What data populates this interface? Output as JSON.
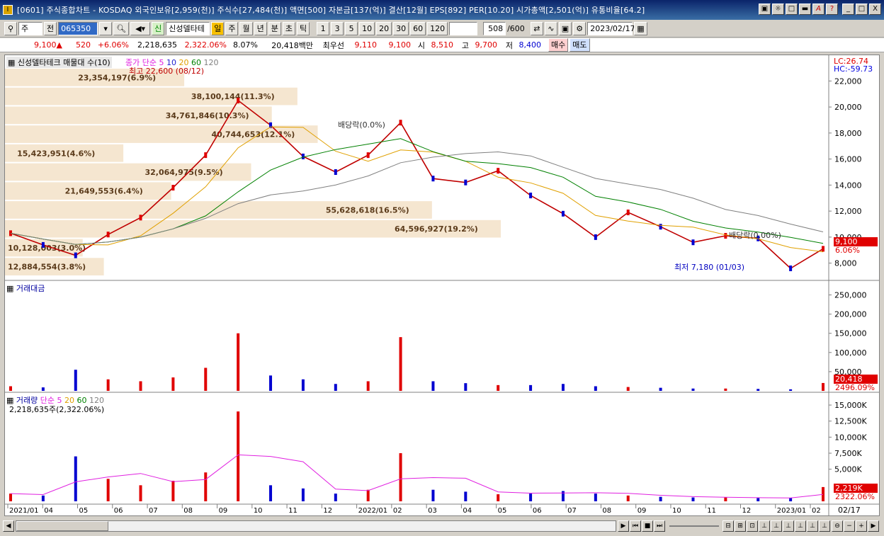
{
  "window": {
    "title": "[0601] 주식종합차트 - KOSDAQ 외국인보유[2,959(천)] 주식수[27,484(천)] 액면[500] 자본금[137(억)] 결산[12월] EPS[892] PER[10.20] 시가총액[2,501(억)] 유통비율[64.2]",
    "buttons": [
      "▣",
      "☼",
      "□",
      "▬",
      "A",
      "?",
      "_",
      "□",
      "X"
    ]
  },
  "toolbar": {
    "period_type": "주",
    "prev": "전",
    "code": "065350",
    "stock_name": "신성델타테",
    "badge": "신",
    "tabs": [
      "일",
      "주",
      "월",
      "년",
      "분",
      "초",
      "틱"
    ],
    "intervals": [
      "1",
      "3",
      "5",
      "10",
      "20",
      "30",
      "60",
      "120"
    ],
    "count": "508",
    "count_total": "/600",
    "date": "2023/02/17"
  },
  "quote": {
    "price": "9,100▲",
    "change": "520",
    "change_pct": "+6.06%",
    "volume": "2,218,635",
    "vol_ratio": "2,322.06%",
    "turnover": "8.07%",
    "amount": "20,418백만",
    "pref_label": "최우선",
    "pref_ask": "9,110",
    "pref_bid": "9,100",
    "open_label": "시",
    "open": "8,510",
    "high_label": "고",
    "high": "9,700",
    "low_label": "저",
    "low": "8,400",
    "buy": "매수",
    "sell": "매도"
  },
  "price_panel": {
    "title": "신성델타테크 매물대 수(10)",
    "ma_label": "종가 단순",
    "ma_periods": [
      "5",
      "10",
      "20",
      "60",
      "120"
    ],
    "ma_colors": [
      "#e020e0",
      "#2020d0",
      "#e0a000",
      "#008000",
      "#808080"
    ],
    "lc": "LC:26.74",
    "hc": "HC:-59.73",
    "high_note": "최고 22,600 (08/12)",
    "low_note": "최저 7,180 (01/03)",
    "dividend_notes": [
      "배당락(0.0%)",
      "배당락(0.00%)"
    ],
    "current_price": "9,100",
    "current_pct": "6.06%",
    "yaxis": [
      "22,000",
      "20,000",
      "18,000",
      "16,000",
      "14,000",
      "12,000",
      "10,000",
      "8,000"
    ],
    "volume_profile": [
      {
        "label": "23,354,197(6.9%)",
        "value": 23354197
      },
      {
        "label": "38,100,144(11.3%)",
        "value": 38100144
      },
      {
        "label": "34,761,846(10.3%)",
        "value": 34761846
      },
      {
        "label": "40,744,653(12.1%)",
        "value": 40744653
      },
      {
        "label": "15,423,951(4.6%)",
        "value": 15423951
      },
      {
        "label": "32,064,975(9.5%)",
        "value": 32064975
      },
      {
        "label": "21,649,553(6.4%)",
        "value": 21649553
      },
      {
        "label": "55,628,618(16.5%)",
        "value": 55628618
      },
      {
        "label": "64,596,927(19.2%)",
        "value": 64596927
      },
      {
        "label": "10,128,003(3.0%)",
        "value": 10128003
      },
      {
        "label": "12,884,554(3.8%)",
        "value": 12884554
      }
    ]
  },
  "amount_panel": {
    "title": "거래대금",
    "yaxis": [
      "250,000",
      "200,000",
      "150,000",
      "100,000",
      "50,000"
    ],
    "current": "20,418",
    "current_pct": "2496.09%"
  },
  "volume_panel": {
    "title": "거래량",
    "ma_label": "단순",
    "ma_periods": [
      "5",
      "20",
      "60",
      "120"
    ],
    "summary": "2,218,635주(2,322.06%)",
    "yaxis": [
      "15,000K",
      "12,500K",
      "10,000K",
      "7,500K",
      "5,000K"
    ],
    "current": "2,219K",
    "current_pct": "2322.06%"
  },
  "xaxis": [
    "2021/01",
    "04",
    "05",
    "06",
    "07",
    "08",
    "09",
    "10",
    "11",
    "12",
    "2022/01",
    "02",
    "03",
    "04",
    "05",
    "06",
    "07",
    "08",
    "09",
    "10",
    "11",
    "12",
    "2023/01",
    "02"
  ],
  "xaxis_right": "02/17",
  "chart_data": {
    "type": "line",
    "title": "신성델타테크",
    "x": [
      "2021/01",
      "2021/02",
      "2021/03",
      "2021/04",
      "2021/05",
      "2021/06",
      "2021/07",
      "2021/08",
      "2021/09",
      "2021/10",
      "2021/11",
      "2021/12",
      "2022/01",
      "2022/02",
      "2022/03",
      "2022/04",
      "2022/05",
      "2022/06",
      "2022/07",
      "2022/08",
      "2022/09",
      "2022/10",
      "2022/11",
      "2022/12",
      "2023/01",
      "2023/02"
    ],
    "series": [
      {
        "name": "종가",
        "values": [
          10300,
          9400,
          8600,
          10200,
          11500,
          13800,
          16300,
          20500,
          18600,
          16200,
          15000,
          16300,
          18800,
          14500,
          14200,
          15100,
          13200,
          11800,
          10000,
          11900,
          10800,
          9600,
          10100,
          9900,
          7600,
          9100
        ]
      }
    ],
    "ylim": [
      7000,
      23000
    ],
    "amount_values": [
      12000,
      9000,
      55000,
      30000,
      25000,
      35000,
      60000,
      150000,
      40000,
      30000,
      18000,
      25000,
      140000,
      25000,
      20000,
      15000,
      15000,
      18000,
      12000,
      10000,
      8000,
      6000,
      6000,
      5000,
      4000,
      20418
    ],
    "volume_values": [
      1200,
      900,
      7000,
      3500,
      2500,
      3200,
      4500,
      14000,
      2500,
      2000,
      1200,
      1800,
      7500,
      1800,
      1500,
      1100,
      1200,
      1600,
      1200,
      900,
      700,
      600,
      600,
      500,
      500,
      2219
    ],
    "volume_unit": "K"
  }
}
